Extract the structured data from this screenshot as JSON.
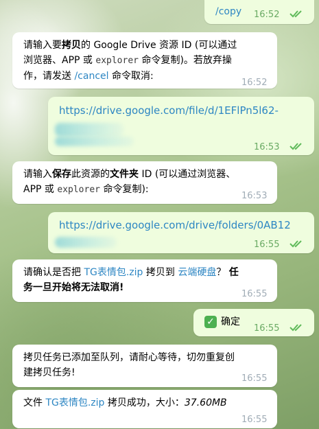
{
  "messages": {
    "m1": {
      "text": "/copy",
      "time": "16:52"
    },
    "m2": {
      "p1": "请输入要",
      "p2": "拷贝",
      "p3": "的 Google Drive 资源 ID (可以通过",
      "p4": "浏览器、APP 或",
      "p5": "explorer",
      "p6": "命令复制)。若放弃操",
      "p7": "作，请发送",
      "p8": "/cancel",
      "p9": "命令取消:",
      "time": "16:52"
    },
    "m3": {
      "link": "https://drive.google.com/file/d/1EFlPn5l62-",
      "time": "16:53"
    },
    "m4": {
      "p1": "请输入",
      "p2": "保存",
      "p3": "此资源的",
      "p4": "文件夹",
      "p5": "ID (可以通过浏览器、",
      "p6": "APP 或",
      "p7": "explorer",
      "p8": "命令复制):",
      "time": "16:53"
    },
    "m5": {
      "link": "https://drive.google.com/drive/folders/0AB12",
      "time": "16:55"
    },
    "m6": {
      "p1": "请确认是否把",
      "p2": "TG表情包.zip",
      "p3": "拷贝到",
      "p4": "云端硬盘",
      "p5": "？",
      "p6": "任",
      "p7": "务一旦开始将无法取消!",
      "time": "16:55"
    },
    "m7": {
      "emoji": "✓",
      "text": "确定",
      "time": "16:55"
    },
    "m8": {
      "line1": "拷贝任务已添加至队列，请耐心等待，切勿重复创",
      "line2": "建拷贝任务!",
      "time": "16:55"
    },
    "m9": {
      "p1": "文件",
      "p2": "TG表情包.zip",
      "p3": "拷贝成功，大小：",
      "p4": "37.60MB",
      "time": "16:55"
    }
  },
  "colors": {
    "incoming": "#ffffff",
    "outgoing": "#effdde",
    "link": "#2d86c3",
    "ticks": "#5fba5a"
  }
}
